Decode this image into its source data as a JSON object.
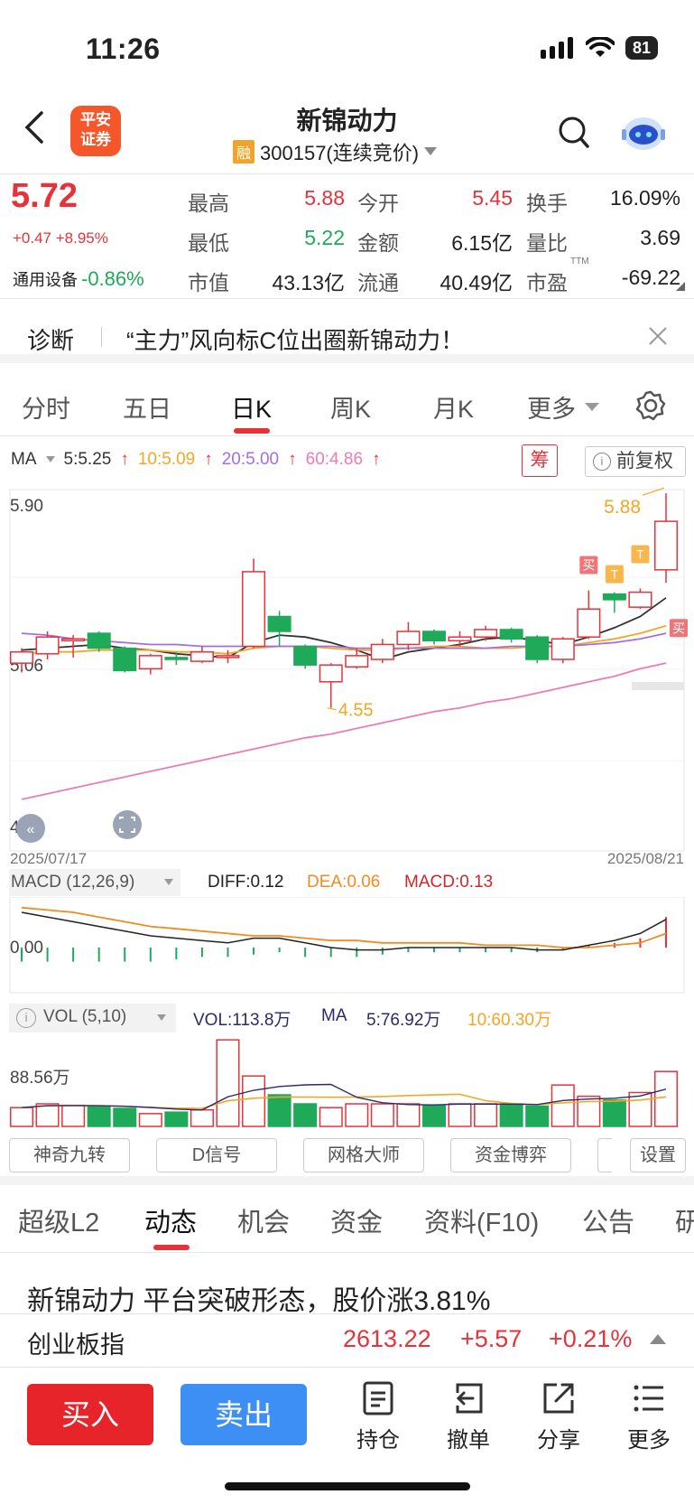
{
  "status": {
    "time": "11:26",
    "battery": "81"
  },
  "header": {
    "title": "新锦动力",
    "margin_tag": "融",
    "code": "300157(连续竞价)",
    "logo_line1": "平安",
    "logo_line2": "证券"
  },
  "quote": {
    "price": "5.72",
    "change": "+0.47  +8.95%",
    "sector_name": "通用设备",
    "sector_change": "-0.86%",
    "fields": [
      {
        "label": "最高",
        "value": "5.88"
      },
      {
        "label": "今开",
        "value": "5.45"
      },
      {
        "label": "换手",
        "value": "16.09%"
      },
      {
        "label": "最低",
        "value": "5.22"
      },
      {
        "label": "金额",
        "value": "6.15亿"
      },
      {
        "label": "量比",
        "value": "3.69"
      },
      {
        "label": "市值",
        "value": "43.13亿"
      },
      {
        "label": "流通",
        "value": "40.49亿"
      },
      {
        "label": "市盈",
        "value": "-69.22"
      }
    ],
    "pe_tag": "TTM"
  },
  "banner": {
    "tag": "诊断",
    "text": "“主力”风向标C位出圈新锦动力！"
  },
  "chart_tabs": [
    "分时",
    "五日",
    "日K",
    "周K",
    "月K",
    "更多"
  ],
  "ma_legend": {
    "label": "MA",
    "ma5": "5:5.25",
    "ma10": "10:5.09",
    "ma20": "20:5.00",
    "ma60": "60:4.86",
    "chip": "筹",
    "adjust": "前复权"
  },
  "colors": {
    "up": "#e8323a",
    "down": "#1faa5a",
    "ma5": "#333333",
    "ma10": "#f5a623",
    "ma20": "#a56ee0",
    "ma60": "#f07ab4",
    "buy": "#e8242b",
    "sell": "#3d8ff5"
  },
  "chart_data": {
    "type": "candlestick",
    "price_axis": {
      "top_label": "5.90",
      "mid_label": "5.06",
      "bottom_label": "4.23"
    },
    "start_date": "2025/07/17",
    "end_date": "2025/08/21",
    "high_label": "5.88",
    "low_label": "4.55",
    "candles": [
      {
        "o": 4.97,
        "c": 5.03,
        "h": 5.05,
        "l": 4.92
      },
      {
        "o": 5.02,
        "c": 5.11,
        "h": 5.14,
        "l": 4.99
      },
      {
        "o": 5.09,
        "c": 5.1,
        "h": 5.12,
        "l": 5.0
      },
      {
        "o": 5.13,
        "c": 5.05,
        "h": 5.14,
        "l": 5.03
      },
      {
        "o": 5.05,
        "c": 4.93,
        "h": 5.06,
        "l": 4.92
      },
      {
        "o": 4.94,
        "c": 5.01,
        "h": 5.02,
        "l": 4.91
      },
      {
        "o": 5.0,
        "c": 4.99,
        "h": 5.03,
        "l": 4.96
      },
      {
        "o": 4.98,
        "c": 5.03,
        "h": 5.06,
        "l": 4.97
      },
      {
        "o": 5.01,
        "c": 5.01,
        "h": 5.04,
        "l": 4.97
      },
      {
        "o": 5.06,
        "c": 5.46,
        "h": 5.53,
        "l": 5.05
      },
      {
        "o": 5.22,
        "c": 5.14,
        "h": 5.25,
        "l": 5.06
      },
      {
        "o": 5.06,
        "c": 4.96,
        "h": 5.07,
        "l": 4.94
      },
      {
        "o": 4.87,
        "c": 4.96,
        "h": 4.97,
        "l": 4.73
      },
      {
        "o": 4.95,
        "c": 5.01,
        "h": 5.05,
        "l": 4.94
      },
      {
        "o": 4.99,
        "c": 5.07,
        "h": 5.1,
        "l": 4.97
      },
      {
        "o": 5.07,
        "c": 5.14,
        "h": 5.19,
        "l": 5.04
      },
      {
        "o": 5.14,
        "c": 5.09,
        "h": 5.15,
        "l": 5.07
      },
      {
        "o": 5.09,
        "c": 5.11,
        "h": 5.14,
        "l": 5.06
      },
      {
        "o": 5.11,
        "c": 5.15,
        "h": 5.17,
        "l": 5.09
      },
      {
        "o": 5.15,
        "c": 5.1,
        "h": 5.16,
        "l": 5.08
      },
      {
        "o": 5.11,
        "c": 4.99,
        "h": 5.12,
        "l": 4.97
      },
      {
        "o": 4.99,
        "c": 5.1,
        "h": 5.11,
        "l": 4.97
      },
      {
        "o": 5.11,
        "c": 5.26,
        "h": 5.36,
        "l": 5.1
      },
      {
        "o": 5.34,
        "c": 5.31,
        "h": 5.35,
        "l": 5.24
      },
      {
        "o": 5.27,
        "c": 5.35,
        "h": 5.37,
        "l": 5.26
      },
      {
        "o": 5.47,
        "c": 5.73,
        "h": 5.88,
        "l": 5.4
      }
    ],
    "ma_series": [
      {
        "name": "MA5",
        "values": [
          5.04,
          5.05,
          5.06,
          5.07,
          5.05,
          5.04,
          5.02,
          5.01,
          5.0,
          5.08,
          5.12,
          5.11,
          5.08,
          5.04,
          4.99,
          5.03,
          5.05,
          5.07,
          5.1,
          5.11,
          5.09,
          5.07,
          5.11,
          5.16,
          5.22,
          5.32
        ]
      },
      {
        "name": "MA10",
        "values": [
          5.02,
          5.03,
          5.03,
          5.04,
          5.04,
          5.04,
          5.03,
          5.03,
          5.02,
          5.05,
          5.06,
          5.06,
          5.05,
          5.04,
          5.04,
          5.05,
          5.06,
          5.06,
          5.05,
          5.05,
          5.06,
          5.06,
          5.08,
          5.1,
          5.13,
          5.17
        ]
      },
      {
        "name": "MA20",
        "values": [
          5.13,
          5.12,
          5.1,
          5.09,
          5.08,
          5.07,
          5.07,
          5.06,
          5.06,
          5.06,
          5.06,
          5.06,
          5.06,
          5.05,
          5.05,
          5.05,
          5.05,
          5.05,
          5.05,
          5.06,
          5.06,
          5.06,
          5.07,
          5.08,
          5.1,
          5.13
        ]
      },
      {
        "name": "MA60",
        "values": [
          4.24,
          4.27,
          4.3,
          4.33,
          4.36,
          4.39,
          4.42,
          4.45,
          4.48,
          4.51,
          4.54,
          4.57,
          4.59,
          4.62,
          4.65,
          4.68,
          4.71,
          4.73,
          4.76,
          4.78,
          4.81,
          4.84,
          4.87,
          4.9,
          4.94,
          4.97
        ]
      }
    ],
    "signals": [
      {
        "text": "买",
        "index": 22
      },
      {
        "text": "T",
        "index": 23
      },
      {
        "text": "T",
        "index": 24
      },
      {
        "text": "买",
        "index": 25
      }
    ],
    "macd": {
      "label": "MACD (12,26,9)",
      "diff": "DIFF:0.12",
      "dea": "DEA:0.06",
      "macd": "MACD:0.13",
      "zero_label": "0.00",
      "diff_values": [
        0.15,
        0.13,
        0.11,
        0.09,
        0.07,
        0.05,
        0.04,
        0.03,
        0.02,
        0.04,
        0.04,
        0.02,
        0.0,
        -0.01,
        -0.01,
        0.0,
        0.0,
        0.0,
        0.0,
        0.0,
        -0.01,
        -0.01,
        0.01,
        0.03,
        0.06,
        0.12
      ],
      "dea_values": [
        0.17,
        0.16,
        0.15,
        0.13,
        0.11,
        0.09,
        0.08,
        0.07,
        0.06,
        0.05,
        0.05,
        0.04,
        0.03,
        0.03,
        0.02,
        0.02,
        0.02,
        0.02,
        0.01,
        0.01,
        0.01,
        0.0,
        0.0,
        0.01,
        0.02,
        0.06
      ],
      "hist_values": [
        -0.06,
        -0.06,
        -0.06,
        -0.06,
        -0.06,
        -0.06,
        -0.05,
        -0.04,
        -0.04,
        -0.03,
        -0.02,
        -0.04,
        -0.04,
        -0.04,
        -0.03,
        -0.02,
        -0.02,
        -0.02,
        -0.02,
        -0.02,
        -0.02,
        -0.01,
        0.01,
        0.02,
        0.04,
        0.13
      ]
    },
    "volume": {
      "label": "VOL (5,10)",
      "vol": "VOL:113.8万",
      "ma_label": "MA",
      "ma5": "5:76.92万",
      "ma10": "10:60.30万",
      "axis_label": "88.56万",
      "values": [
        25,
        30,
        28,
        27,
        24,
        17,
        19,
        22,
        115,
        67,
        42,
        30,
        25,
        30,
        30,
        30,
        28,
        30,
        30,
        30,
        27,
        55,
        40,
        35,
        45,
        73
      ]
    }
  },
  "tools": [
    "神奇九转",
    "D信号",
    "网格大师",
    "资金博弈",
    "设置"
  ],
  "info_tabs": [
    "超级L2",
    "动态",
    "机会",
    "资金",
    "资料(F10)",
    "公告",
    "研"
  ],
  "news_headline": "新锦动力 平台突破形态，股价涨3.81%",
  "index_bar": {
    "name": "创业板指",
    "value": "2613.22",
    "change": "+5.57",
    "percent": "+0.21%"
  },
  "actions": {
    "buy": "买入",
    "sell": "卖出",
    "items": [
      "持仓",
      "撤单",
      "分享",
      "更多"
    ]
  }
}
